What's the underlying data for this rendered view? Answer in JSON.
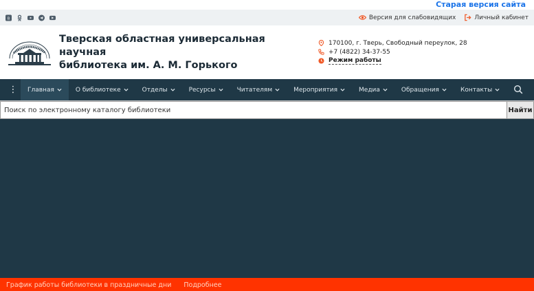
{
  "top": {
    "old_version_link": "Старая версия сайта"
  },
  "utility": {
    "socials": [
      "vk-icon",
      "ok-icon",
      "youtube-icon",
      "telegram-icon",
      "rutube-icon"
    ],
    "accessibility_label": "Версия для слабовидящих",
    "account_label": "Личный кабинет"
  },
  "header": {
    "title_line1": "Тверская областная универсальная научная",
    "title_line2": "библиотека им. А. М. Горького",
    "address": "170100, г. Тверь, Свободный переулок, 28",
    "phone": "+7 (4822) 34-37-55",
    "hours_label": "Режим работы"
  },
  "nav": {
    "items": [
      {
        "label": "Главная"
      },
      {
        "label": "О библиотеке"
      },
      {
        "label": "Отделы"
      },
      {
        "label": "Ресурсы"
      },
      {
        "label": "Читателям"
      },
      {
        "label": "Мероприятия"
      },
      {
        "label": "Медиа"
      },
      {
        "label": "Обращения"
      },
      {
        "label": "Контакты"
      }
    ]
  },
  "search": {
    "placeholder": "Поиск по электронному каталогу библиотеки",
    "button_label": "Найти"
  },
  "banner": {
    "text": "График работы библиотеки в праздничные дни",
    "more_label": "Подробнее"
  },
  "colors": {
    "nav_bg": "#1f3846",
    "accent": "#ff3300",
    "icon_orange": "#f05a28",
    "link_blue": "#1a73e8"
  }
}
